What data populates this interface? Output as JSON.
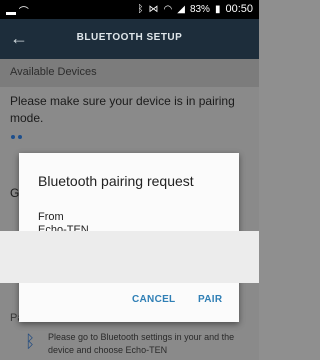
{
  "status_bar": {
    "left_icons": [
      "screen-cast-icon",
      "headset-icon"
    ],
    "right_icons": [
      "bluetooth-icon",
      "vibrate-icon",
      "wifi-icon",
      "signal-icon"
    ],
    "battery": "83%",
    "time": "00:50"
  },
  "app_bar": {
    "title": "BLUETOOTH SETUP"
  },
  "page": {
    "section_header": "Available Devices",
    "instruction": "Please make sure your device is in pairing mode.",
    "partial_g": "G",
    "partial_pa": "Pa",
    "bt_note": "Please go to Bluetooth settings in your and the device and choose Echo-TEN"
  },
  "dialog": {
    "title": "Bluetooth pairing request",
    "from_label": "From",
    "device_name": "Echo-TEN",
    "cancel_label": "CANCEL",
    "pair_label": "PAIR"
  }
}
